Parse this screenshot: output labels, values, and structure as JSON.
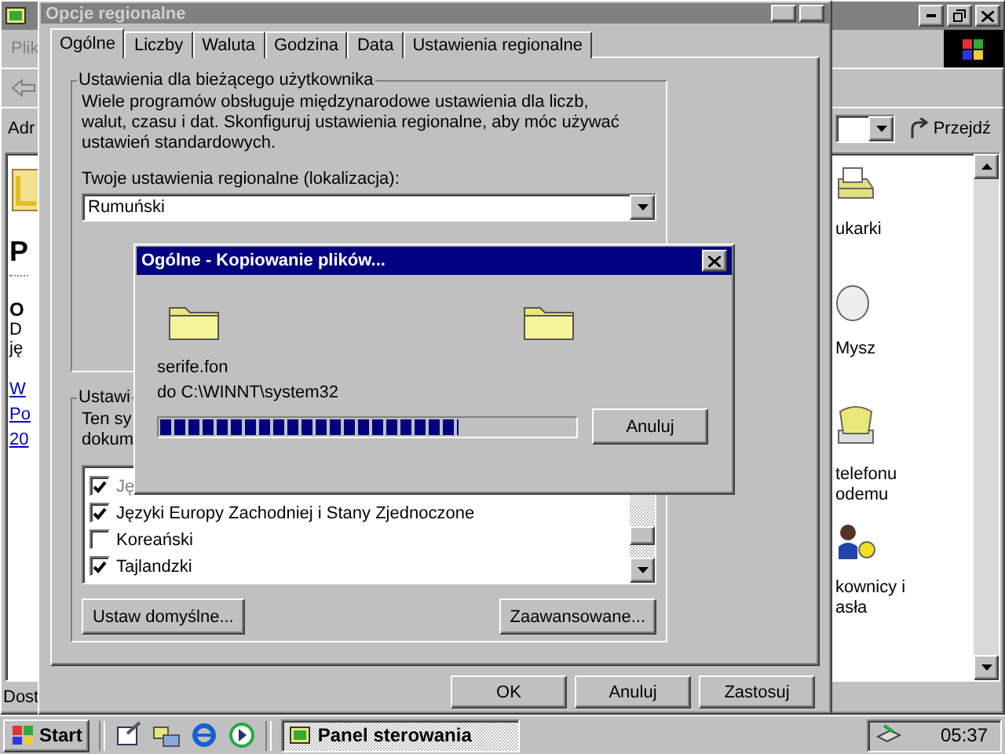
{
  "explorer": {
    "menu": [
      {
        "label": "Plik"
      }
    ],
    "address_label": "Adr",
    "go_button": "Przejdź",
    "left_pane": [
      {
        "kind": "heading",
        "text": "P"
      },
      {
        "kind": "subheading",
        "text": "O"
      },
      {
        "kind": "text",
        "text": "D"
      },
      {
        "kind": "text",
        "text": "ję"
      },
      {
        "kind": "link",
        "text": "W"
      },
      {
        "kind": "link",
        "text": "Po"
      },
      {
        "kind": "link",
        "text": "20"
      }
    ],
    "icons": [
      {
        "kind": "printer",
        "lines": [
          "ukarki"
        ]
      },
      {
        "kind": "mouse",
        "lines": [
          "Mysz"
        ]
      },
      {
        "kind": "phone",
        "lines": [
          "telefonu",
          "odemu"
        ]
      },
      {
        "kind": "users",
        "lines": [
          "kownicy i",
          "asła"
        ]
      }
    ],
    "status": "Dost"
  },
  "regional_dialog": {
    "title": "Opcje regionalne",
    "tabs": [
      {
        "label": "Ogólne",
        "selected": true
      },
      {
        "label": "Liczby",
        "selected": false
      },
      {
        "label": "Waluta",
        "selected": false
      },
      {
        "label": "Godzina",
        "selected": false
      },
      {
        "label": "Data",
        "selected": false
      },
      {
        "label": "Ustawienia regionalne",
        "selected": false
      }
    ],
    "user_group": {
      "title": "Ustawienia dla bieżącego użytkownika",
      "description": "Wiele programów obsługuje międzynarodowe ustawienia dla liczb, walut, czasu i dat. Skonfiguruj ustawienia regionalne, aby móc używać ustawień standardowych.",
      "locale_label": "Twoje ustawienia regionalne (lokalizacja):",
      "locale_value": "Rumuński"
    },
    "language_group": {
      "title": "Ustawi",
      "description_lines": [
        "Ten sy",
        "dokum"
      ],
      "languages": [
        {
          "label": "Ję",
          "checked": true,
          "disabled": true
        },
        {
          "label": "Języki Europy Zachodniej i Stany Zjednoczone",
          "checked": true,
          "disabled": false
        },
        {
          "label": "Koreański",
          "checked": false,
          "disabled": false
        },
        {
          "label": "Tajlandzki",
          "checked": true,
          "disabled": false
        }
      ],
      "buttons": [
        "Ustaw domyślne...",
        "Zaawansowane..."
      ]
    },
    "buttons": [
      "OK",
      "Anuluj",
      "Zastosuj"
    ]
  },
  "copy_dialog": {
    "title": "Ogólne - Kopiowanie plików...",
    "file": "serife.fon",
    "destination": "do C:\\WINNT\\system32",
    "level": 0.72,
    "button": "Anuluj"
  },
  "taskbar": {
    "start": "Start",
    "tasks": [
      {
        "label": "Panel sterowania",
        "selected": true
      }
    ],
    "clock": "05:37"
  }
}
